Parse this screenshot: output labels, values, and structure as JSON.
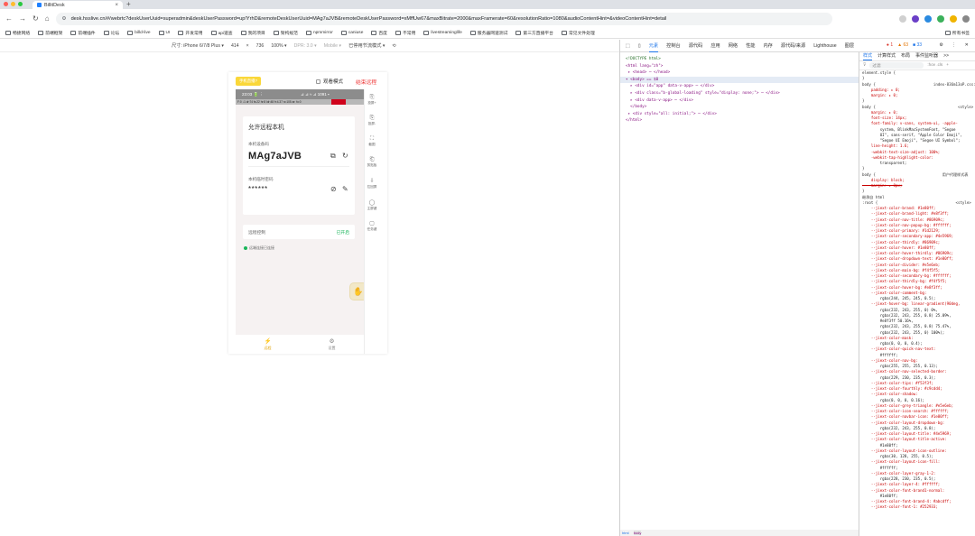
{
  "browser": {
    "tab_title": "BillitDesk",
    "url": "desk.hsslive.cn/#/webrtc?deskUserUuid=superadmin&deskUserPassword=up!YrhD&remoteDeskUserUuid=MAg7aJVB&remoteDeskUserPassword=xMffUw67&maxBitrate=2000&maxFramerate=60&resolutionRatio=1080&audioContentHint=&videoContentHint=detail",
    "bookmarks": [
      "畅捷网络",
      "前端框架",
      "前端插件",
      "论坛",
      "billd-live",
      "UI",
      "开发常用",
      "api速查",
      "我的项目",
      "架构规范",
      "npmmirror",
      "caniuse",
      "百度",
      "不常用",
      "livestreaminglife",
      "服务器网速测试",
      "第三方直播平台",
      "常见文件处理"
    ],
    "other_bookmarks": "所有书签"
  },
  "device_toolbar": {
    "device": "尺寸: iPhone 6/7/8 Plus ▾",
    "width": "414",
    "times": "×",
    "height": "736",
    "zoom": "100% ▾",
    "dpr": "DPR: 3.0 ▾",
    "mode": "Mobile ▾",
    "throttle": "已停用节流模式 ▾"
  },
  "phone": {
    "badge": "手机直播?",
    "view_mode": "观看模式",
    "end_button": "结束远程",
    "status_left": "23:03 🔋 ⋮",
    "status_right": "⊿ ⊿ ≈ ⊿ 1091 ▪",
    "status_row2": "F:0   ↓1    dr:74   fs:22    hr:8    ldr:48    fr:4.37    rc:105    ar:   fo:0",
    "card_title": "允许远程本机",
    "device_code_label": "本机设备码",
    "device_code": "MAg7aJVB",
    "password_label": "本机临时密码",
    "password": "******",
    "control_label": "远程控制",
    "control_action": "已开启",
    "connection_status": "远端连接已连接",
    "bottom_nav": [
      {
        "icon": "⚡",
        "label": "远程"
      },
      {
        "icon": "⚙",
        "label": "设置"
      }
    ],
    "rail": [
      {
        "icon": "⎘",
        "label": "投屏+"
      },
      {
        "icon": "⎘",
        "label": "投屏-"
      },
      {
        "icon": "⛶",
        "label": "截图"
      },
      {
        "icon": "⎗",
        "label": "剪贴板"
      },
      {
        "icon": "⇩",
        "label": "拉回屏"
      },
      {
        "icon": "◯",
        "label": "主屏键"
      },
      {
        "icon": "▢",
        "label": "任务键"
      }
    ]
  },
  "devtools": {
    "tabs": [
      "元素",
      "控制台",
      "源代码",
      "应用",
      "网络",
      "性能",
      "内存",
      "源代码/来源",
      "Lighthouse",
      "图层"
    ],
    "active_tab": "元素",
    "errors": "1",
    "warnings": "63",
    "infos": "33",
    "elements_lines": [
      "<!DOCTYPE html>",
      "<html lang=\"zh\">",
      " ▸ <head> ⋯ </head>",
      "▾ <body> == $0",
      "  ▸ <div id=\"app\" data-v-app> ⋯ </div>",
      "  ▸ <div class=\"b-global-loading\" style=\"display: none;\"> ⋯ </div>",
      "  ▸ <div data-v-app> ⋯ </div>",
      "  </body>",
      " ▸ <div style=\"all: initial;\"> ⋯ </div>",
      "</html>"
    ],
    "footer_tags": [
      "html",
      "body"
    ],
    "styles_tabs": [
      "样式",
      "计算样式",
      "布局",
      "事件监听器",
      ">>"
    ],
    "styles_active": "样式",
    "filter_placeholder": "过滤",
    "filter_hov": ":hov .cls",
    "styles_lines": [
      "element.style {",
      "}",
      "body {                          index-836m13oP.css:1",
      "    padding: ▸ 0;",
      "    margin: ▸ 0;",
      "}",
      "body {                                     <style>",
      "    margin: ▸ 0;",
      "    font-size: 14px;",
      "    font-family: v-sans, system-ui, -apple-",
      "        system, BlinkMacSystemFont, \"Segoe",
      "        UI\", sans-serif, \"Apple Color Emoji\",",
      "        \"Segoe UI Emoji\", \"Segoe UI Symbol\";",
      "    line-height: 1.6;",
      "    -webkit-text-size-adjust: 100%;",
      "    -webkit-tap-highlight-color:",
      "        transparent;",
      "}",
      "body {                              用户代理样式表",
      "    display: block;",
      "    margin: ▸ 8px;",
      "}",
      "继承自 html",
      ":root {                                   <style>",
      "    --jiext-color-brand: #1e80ff;",
      "    --jiext-color-brand-light: #e8f3ff;",
      "    --jiext-color-nav-title: #86909c;",
      "    --jiext-color-nav-popup-bg: #ffffff;",
      "    --jiext-color-primary: #1d2129;",
      "    --jiext-color-secondary-app: #4e5969;",
      "    --jiext-color-thirdly: #86909c;",
      "    --jiext-color-hover: #1e80ff;",
      "    --jiext-color-hover-thirdly: #86909c;",
      "    --jiext-color-dropdown-text: #1e80ff;",
      "    --jiext-color-divider: #e5e6eb;",
      "    --jiext-color-main-bg: #f4f5f5;",
      "    --jiext-color-secondary-bg: #ffffff;",
      "    --jiext-color-thirdly-bg: #f4f5f5;",
      "    --jiext-color-hover-bg: #e8f3ff;",
      "    --jiext-color-comment-bg:",
      "        rgba(244, 245, 245, 0.5);",
      "    --jiext-hover-bg: linear-gradient(90deg,",
      "        rgba(232, 243, 255, 0) 0%,",
      "        rgba(232, 243, 255, 0.8) 25.09%,",
      "        #e8f3ff 50.16%,",
      "        rgba(232, 243, 255, 0.8) 75.47%,",
      "        rgba(232, 243, 255, 0) 100%);",
      "    --jiext-color-mask:",
      "        rgba(0, 0, 0, 0.4);",
      "    --jiext-color-quick-nav-text:",
      "        #ffffff;",
      "    --jiext-color-nav-bg:",
      "        rgba(255, 255, 255, 0.13);",
      "    --jiext-color-nav-selected-border:",
      "        rgba(229, 230, 235, 0.3);",
      "    --jiext-color-tips: #f53f3f;",
      "    --jiext-color-fourthly: #c9cdd4;",
      "    --jiext-color-shadow:",
      "        rgba(0, 0, 0, 0.16);",
      "    --jiext-color-grey-triangle: #e5e6eb;",
      "    --jiext-color-icon-search: #ffffff;",
      "    --jiext-color-navbar-icon: #1e80ff;",
      "    --jiext-color-layout-dropdown-bg:",
      "        rgba(232, 243, 255, 0.8);",
      "    --jiext-color-layout-title: #4e5969;",
      "    --jiext-color-layout-title-active:",
      "        #1e80ff;",
      "    --jiext-color-layout-icon-outline:",
      "        rgba(30, 128, 255, 0.5);",
      "    --jiext-color-layout-icon-fill:",
      "        #ffffff;",
      "    --jiext-color-layer-gray-1-2:",
      "        rgba(228, 230, 235, 0.5);",
      "    --jiext-color-layer-4: #ffffff;",
      "    --jiext-color-font-brand1-normal:",
      "        #1e80ff;",
      "    --jiext-color-font-brand-4: #abcdff;",
      "    --jiext-color-font-1: #252933;"
    ]
  },
  "colors": {
    "accent": "#1e80ff",
    "end_button": "#ee3333",
    "badge": "#fad739",
    "green": "#1ab55a"
  }
}
